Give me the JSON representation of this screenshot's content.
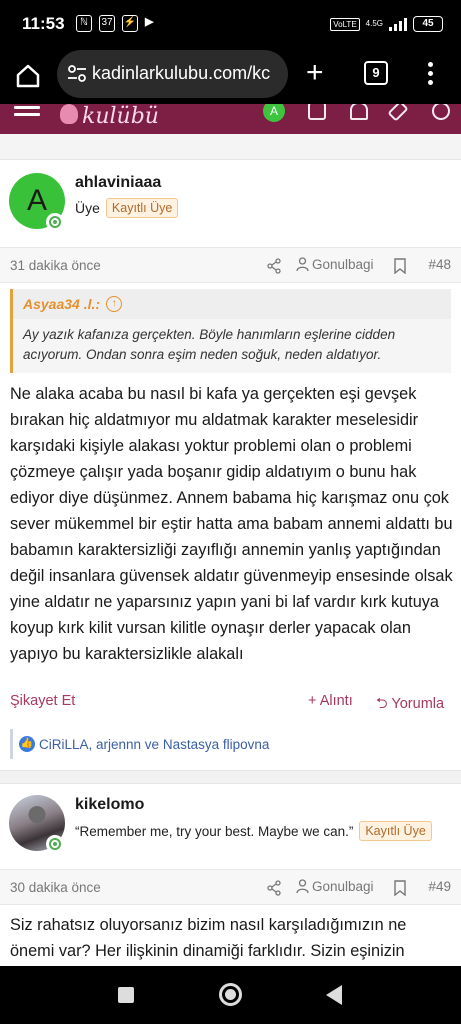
{
  "status_bar": {
    "time": "11:53",
    "icons": [
      "ℕ",
      "37",
      "⚡",
      "▶"
    ],
    "volte": "VoLTE",
    "network": "4.5G",
    "battery": "45"
  },
  "browser": {
    "url": "kadinlarkulubu.com/kc",
    "tab_count": "9"
  },
  "site_header": {
    "logo_text": "kulübü",
    "avatar_letter": "A"
  },
  "post1": {
    "username": "ahlaviniaaa",
    "avatar_letter": "A",
    "role": "Üye",
    "badge": "Kayıtlı Üye",
    "time_ago": "31 dakika önce",
    "author_link": "Gonulbagi",
    "post_number": "#48",
    "quote_author": "Asyaa34 .l.:",
    "quote_text": "Ay yazık kafanıza gerçekten. Böyle hanımların eşlerine cidden acıyorum. Ondan sonra eşim neden soğuk, neden aldatıyor.",
    "body": "Ne alaka acaba bu nasıl bi kafa ya gerçekten eşi gevşek bırakan hiç aldatmıyor mu aldatmak karakter meselesidir karşıdaki kişiyle alakası yoktur problemi olan o problemi çözmeye çalışır yada boşanır gidip aldatıyım o bunu hak ediyor diye düşünmez. Annem babama hiç karışmaz onu çok sever mükemmel bir eştir hatta ama babam annemi aldattı bu babamın karaktersizliği zayıflığı annemin yanlış yaptığından değil insanlara güvensek aldatır güvenmeyip ensesinde olsak yine aldatır ne yaparsınız yapın yani bi laf vardır kırk kutuya koyup kırk kilit vursan kilitle oynaşır derler yapacak olan yapıyo bu karaktersizlikle alakalı",
    "report_label": "Şikayet Et",
    "quote_label": "+ Alıntı",
    "reply_label": "Yorumla",
    "reactions_text": "CiRiLLA, arjennn ve Nastasya flipovna"
  },
  "post2": {
    "username": "kikelomo",
    "signature": "“Remember me, try your best. Maybe we can.”",
    "badge": "Kayıtlı Üye",
    "time_ago": "30 dakika önce",
    "author_link": "Gonulbagi",
    "post_number": "#49",
    "body": "Siz rahatsız oluyorsanız bizim nasıl karşıladığımızın ne önemi var? Her ilişkinin dinamiği farklıdır. Sizin eşinizin"
  }
}
